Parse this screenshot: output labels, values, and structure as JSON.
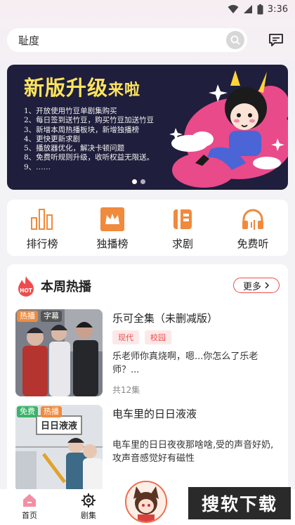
{
  "status": {
    "time": "3:36"
  },
  "search": {
    "placeholder": "耻度"
  },
  "banner": {
    "title_main": "新版升级",
    "title_small": "来啦",
    "lines": [
      "1、开放使用竹豆单剧集购买",
      "2、每日签到送竹豆，购买竹豆加送竹豆",
      "3、新增本周热播板块，新增独播榜",
      "4、更快更新求剧",
      "5、播放器优化，解决卡顿问题",
      "8、免费听规则升级，收听权益无限送。",
      "9、……"
    ],
    "slides": 2,
    "active_slide": 0
  },
  "quick": [
    {
      "label": "排行榜",
      "icon": "bar-chart-icon"
    },
    {
      "label": "独播榜",
      "icon": "crown-icon"
    },
    {
      "label": "求剧",
      "icon": "book-icon"
    },
    {
      "label": "免费听",
      "icon": "headphones-icon"
    }
  ],
  "hot": {
    "badge": "HOT",
    "title": "本周热播",
    "more": "更多",
    "items": [
      {
        "name": "乐可全集（未删减版）",
        "tags": [
          "热播",
          "字幕"
        ],
        "genres": [
          "现代",
          "校园"
        ],
        "desc": "乐老师你真烧啊，嗯...你怎么了乐老师？...",
        "episodes": "共12集"
      },
      {
        "name": "电车里的日日液液",
        "tags": [
          "免费",
          "热播"
        ],
        "cover_text": "日日液液",
        "desc": "电车里的日日夜夜那啥啥,受的声音好奶,攻声音感觉好有磁性"
      }
    ]
  },
  "tabbar": {
    "home": "首页",
    "dramas": "剧集"
  },
  "watermark": "搜软下载",
  "colors": {
    "accent": "#ef4b4b",
    "orange": "#f08a3c"
  }
}
